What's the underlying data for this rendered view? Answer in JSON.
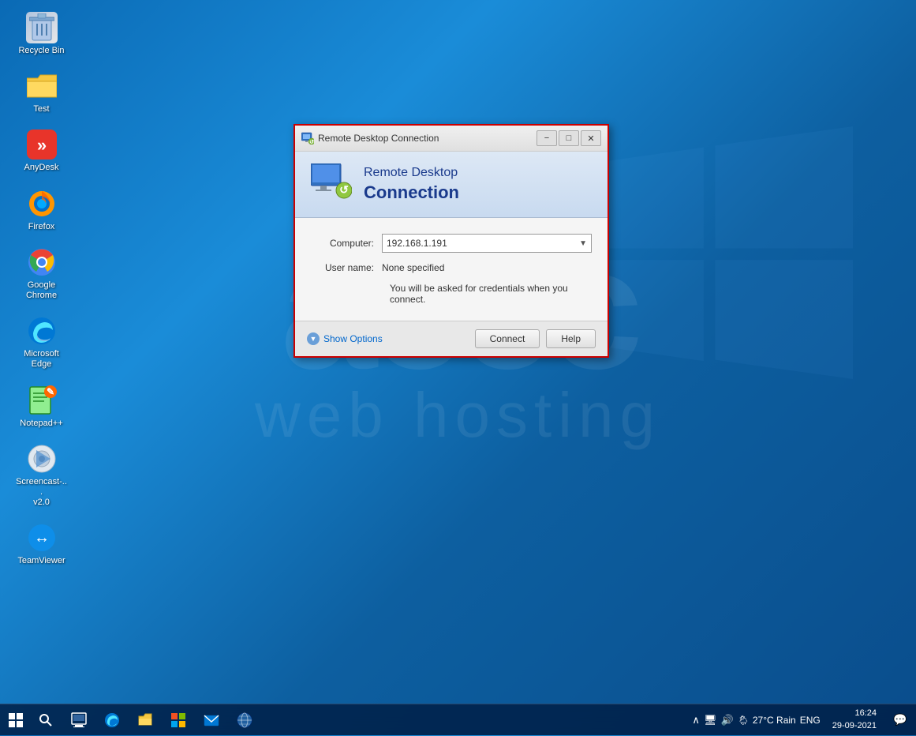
{
  "desktop": {
    "icons": [
      {
        "id": "recycle-bin",
        "label": "Recycle Bin",
        "emoji": "🗑️"
      },
      {
        "id": "test",
        "label": "Test",
        "emoji": "📁"
      },
      {
        "id": "anydesk",
        "label": "AnyDesk",
        "emoji": "❯❯"
      },
      {
        "id": "firefox",
        "label": "Firefox",
        "emoji": "🦊"
      },
      {
        "id": "google-chrome",
        "label": "Google Chrome",
        "emoji": "⊙"
      },
      {
        "id": "microsoft-edge",
        "label": "Microsoft Edge",
        "emoji": "🌀"
      },
      {
        "id": "notepadpp",
        "label": "Notepad++",
        "emoji": "📝"
      },
      {
        "id": "screencast",
        "label": "Screencast-...\nv2.0",
        "emoji": "📹"
      },
      {
        "id": "teamviewer",
        "label": "TeamViewer",
        "emoji": "↔"
      }
    ],
    "watermark_line1": "accc",
    "watermark_line2": "web hosting"
  },
  "dialog": {
    "title": "Remote Desktop Connection",
    "header_line1": "Remote Desktop",
    "header_line2": "Connection",
    "computer_label": "Computer:",
    "computer_value": "192.168.1.191",
    "username_label": "User name:",
    "username_value": "None specified",
    "credentials_msg": "You will be asked for credentials when you connect.",
    "show_options": "Show Options",
    "connect_btn": "Connect",
    "help_btn": "Help"
  },
  "taskbar": {
    "weather": "27°C Rain",
    "language": "ENG",
    "time": "16:24",
    "date": "29-09-2021",
    "apps": [
      "⊞",
      "⌕",
      "⊟",
      "🌀",
      "📁",
      "🏪",
      "✉",
      "🌐"
    ]
  }
}
